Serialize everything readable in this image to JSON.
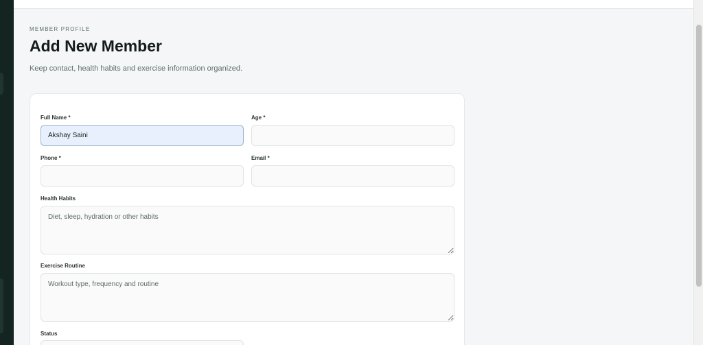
{
  "header": {
    "eyebrow": "MEMBER PROFILE",
    "title": "Add New Member",
    "subtitle": "Keep contact, health habits and exercise information organized."
  },
  "form": {
    "full_name": {
      "label": "Full Name *",
      "value": "Akshay Saini"
    },
    "age": {
      "label": "Age *",
      "value": ""
    },
    "phone": {
      "label": "Phone *",
      "value": ""
    },
    "email": {
      "label": "Email *",
      "value": ""
    },
    "health_habits": {
      "label": "Health Habits",
      "placeholder": "Diet, sleep, hydration or other habits"
    },
    "exercise_routine": {
      "label": "Exercise Routine",
      "placeholder": "Workout type, frequency and routine"
    },
    "status": {
      "label": "Status"
    }
  },
  "colors": {
    "sidebar": "#142420",
    "active_field": "#e8f0fd",
    "page_background": "#f4f6f7"
  }
}
